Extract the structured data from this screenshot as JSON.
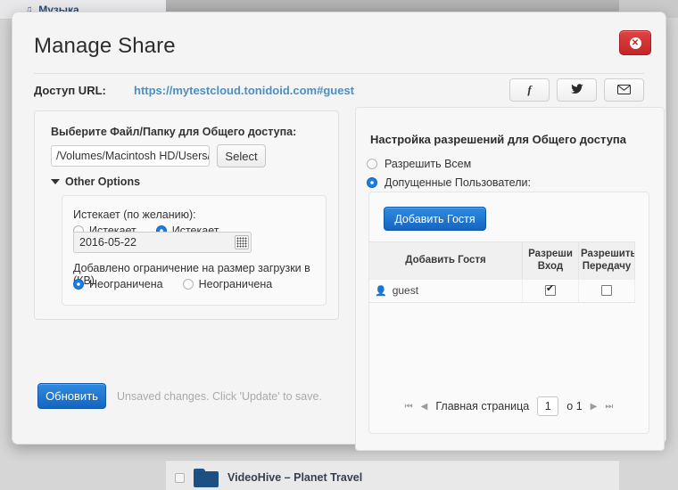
{
  "background": {
    "sidebar_item": {
      "label": "Музыка",
      "icon": "music-note-icon"
    },
    "file_row": {
      "name": "VideoHive – Planet Travel",
      "icon": "folder-icon"
    }
  },
  "dialog": {
    "title": "Manage Share",
    "close_label": "✕",
    "share_url": {
      "label": "Доступ URL:",
      "value": "https://mytestcloud.tonidoid.com#guest"
    },
    "social": [
      {
        "name": "facebook-share-button",
        "glyph": "f"
      },
      {
        "name": "twitter-share-button",
        "glyph": "🐦"
      },
      {
        "name": "email-share-button",
        "glyph": "✉"
      }
    ],
    "left_panel": {
      "select_label": "Выберите Файл/Папку для Общего доступа:",
      "path_value": "/Volumes/Macintosh HD/Users/M",
      "select_button": "Select",
      "other_options_label": "Other Options",
      "expires": {
        "label": "Истекает (по желанию):",
        "option_no": "Истекает",
        "option_yes": "Истекает",
        "selected": "yes",
        "date_value": "2016-05-22",
        "calendar_icon": "calendar-icon"
      },
      "upload_limit": {
        "label": "Добавлено ограничение на размер загрузки в (КВ)",
        "option_unlimited": "Неограничена",
        "option_limited": "Неограничена",
        "selected": "unlimited"
      }
    },
    "footer": {
      "update_button": "Обновить",
      "status_text": "Unsaved changes. Click 'Update' to save."
    },
    "right_panel": {
      "title": "Настройка разрешений для Общего доступа",
      "option_everyone": "Разрешить Всем",
      "option_allowed_users": "Допущенные Пользователи:",
      "selected": "allowed_users",
      "add_guest_button": "Добавить Гостя",
      "table": {
        "columns": [
          "Добавить Гостя",
          "Разреши Вход",
          "Разрешить Передачу"
        ],
        "col_login_line1": "Разреши",
        "col_login_line2": "Вход",
        "col_transfer_line1": "Разрешить",
        "col_transfer_line2": "Передачу",
        "rows": [
          {
            "user": "guest",
            "login": true,
            "transfer": false
          }
        ]
      },
      "pager": {
        "first": "⏮",
        "prev": "◀",
        "label": "Главная страница",
        "page": "1",
        "of": "о 1",
        "next": "▶",
        "last": "⏭"
      }
    }
  },
  "colors": {
    "accent_blue": "#1565c0",
    "link_blue": "#4a90c4",
    "close_red": "#c32626"
  }
}
